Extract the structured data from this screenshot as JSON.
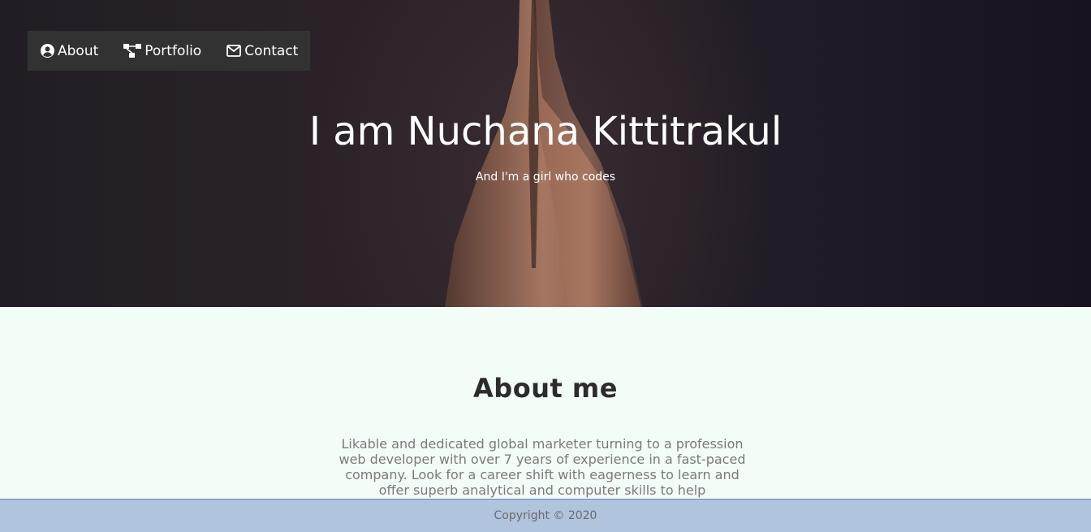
{
  "nav": {
    "items": [
      {
        "label": "About",
        "icon": "user-circle-icon"
      },
      {
        "label": "Portfolio",
        "icon": "sitemap-icon"
      },
      {
        "label": "Contact",
        "icon": "envelope-icon"
      }
    ]
  },
  "hero": {
    "title": "I am Nuchana Kittitrakul",
    "subtitle": "And I'm a girl who codes"
  },
  "about": {
    "heading": "About me",
    "text": "Likable and dedicated global marketer turning to a profession web developer with over 7 years of experience in a fast-paced company. Look for a career shift with eagerness to learn and offer superb analytical and computer skills to help"
  },
  "footer": {
    "copyright": "Copyright © 2020"
  },
  "colors": {
    "nav_bg": "#323232",
    "footer_bg": "#b0c4de",
    "about_bg": "#f3fdf8"
  }
}
